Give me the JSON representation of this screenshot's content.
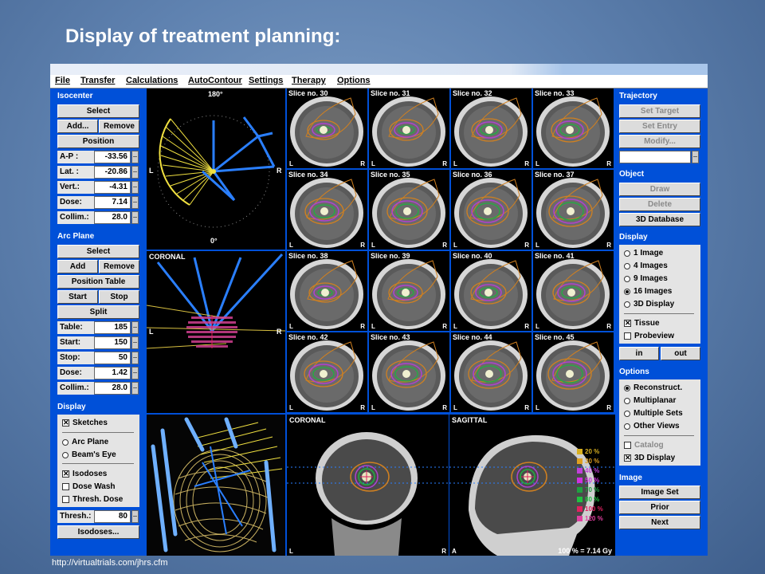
{
  "slide": {
    "title": "Display of treatment planning:",
    "url": "http://virtualtrials.com/jhrs.cfm"
  },
  "menu": [
    "File",
    "Transfer",
    "Calculations",
    "AutoContour",
    "Settings",
    "Therapy",
    "Options"
  ],
  "left": {
    "isocenter": {
      "label": "Isocenter",
      "select": "Select",
      "add": "Add...",
      "remove": "Remove",
      "position": "Position",
      "fields": [
        {
          "label": "A-P  :",
          "value": "-33.56"
        },
        {
          "label": "Lat. :",
          "value": "-20.86"
        },
        {
          "label": "Vert.:",
          "value": "-4.31"
        },
        {
          "label": "Dose:",
          "value": "7.14"
        },
        {
          "label": "Collim.:",
          "value": "28.0"
        }
      ]
    },
    "arc_plane": {
      "label": "Arc Plane",
      "select": "Select",
      "add": "Add",
      "remove": "Remove",
      "position_table": "Position Table",
      "start": "Start",
      "stop": "Stop",
      "split": "Split",
      "fields": [
        {
          "label": "Table:",
          "value": "185"
        },
        {
          "label": "Start:",
          "value": "150"
        },
        {
          "label": "Stop:",
          "value": "50"
        },
        {
          "label": "Dose:",
          "value": "1.42"
        },
        {
          "label": "Collim.:",
          "value": "28.0"
        }
      ]
    },
    "display": {
      "label": "Display",
      "sketches": "Sketches",
      "arc_plane": "Arc Plane",
      "beams_eye": "Beam's Eye",
      "isodoses": "Isodoses",
      "dose_wash": "Dose Wash",
      "thresh_dose": "Thresh. Dose",
      "thresh_label": "Thresh.:",
      "thresh_value": "80",
      "isodoses_btn": "Isodoses..."
    }
  },
  "right": {
    "trajectory": {
      "label": "Trajectory",
      "set_target": "Set Target",
      "set_entry": "Set Entry",
      "modify": "Modify..."
    },
    "object": {
      "label": "Object",
      "draw": "Draw",
      "delete": "Delete",
      "database": "3D Database"
    },
    "display": {
      "label": "Display",
      "options": [
        "1 Image",
        "4 Images",
        "9 Images",
        "16 Images",
        "3D Display"
      ],
      "selected": 3,
      "tissue": "Tissue",
      "probeview": "Probeview",
      "in": "in",
      "out": "out"
    },
    "options": {
      "label": "Options",
      "items": [
        "Reconstruct.",
        "Multiplanar",
        "Multiple Sets",
        "Other Views"
      ],
      "selected": 0,
      "catalog": "Catalog",
      "display3d": "3D Display"
    },
    "image": {
      "label": "Image",
      "image_set": "Image Set",
      "prior": "Prior",
      "next": "Next"
    }
  },
  "views": {
    "arc_angle_top": "180°",
    "arc_angle_bottom": "0°",
    "coronal": "CORONAL",
    "sagittal": "SAGITTAL",
    "L": "L",
    "R": "R",
    "A": "A",
    "slice_prefix": "Slice no.",
    "slices": [
      30,
      31,
      32,
      33,
      34,
      35,
      36,
      37,
      38,
      39,
      40,
      41,
      42,
      43,
      44,
      45
    ],
    "dose_note": "100 % = 7.14 Gy"
  },
  "legend": [
    {
      "label": "20 %",
      "color": "#d8b020"
    },
    {
      "label": "30 %",
      "color": "#e0a020"
    },
    {
      "label": "40 %",
      "color": "#c040d8"
    },
    {
      "label": "50 %",
      "color": "#d030e0"
    },
    {
      "label": "70 %",
      "color": "#20a040"
    },
    {
      "label": "80 %",
      "color": "#20c040"
    },
    {
      "label": "100 %",
      "color": "#e02060"
    },
    {
      "label": "120 %",
      "color": "#e040a0"
    }
  ],
  "colors": {
    "panel_blue": "#0050d8",
    "beam_blue": "#2a7fff",
    "arc_yellow": "#f0e040",
    "isodose_orange": "#d08020",
    "isodose_purple": "#b040d0",
    "isodose_green": "#20b040"
  }
}
